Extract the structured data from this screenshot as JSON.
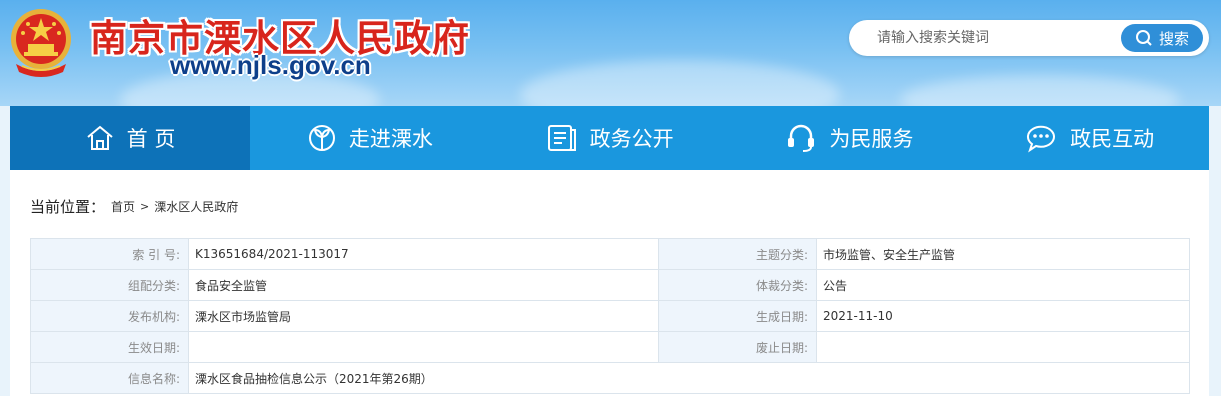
{
  "header": {
    "site_title": "南京市溧水区人民政府",
    "site_url": "www.njls.gov.cn",
    "emblem_icon": "national-emblem-icon"
  },
  "search": {
    "placeholder": "请输入搜索关键词",
    "button_label": "搜索"
  },
  "nav": {
    "items": [
      {
        "label": "首 页",
        "icon": "home-icon"
      },
      {
        "label": "走进溧水",
        "icon": "leaf-icon"
      },
      {
        "label": "政务公开",
        "icon": "document-icon"
      },
      {
        "label": "为民服务",
        "icon": "headset-icon"
      },
      {
        "label": "政民互动",
        "icon": "chat-icon"
      }
    ]
  },
  "breadcrumb": {
    "label": "当前位置：",
    "items": [
      "首页",
      "溧水区人民政府"
    ],
    "separator": ">"
  },
  "info": {
    "rows": [
      [
        {
          "k": "索 引 号:",
          "v": "K13651684/2021-113017"
        },
        {
          "k": "主题分类:",
          "v": "市场监管、安全生产监管"
        }
      ],
      [
        {
          "k": "组配分类:",
          "v": "食品安全监管"
        },
        {
          "k": "体裁分类:",
          "v": "公告"
        }
      ],
      [
        {
          "k": "发布机构:",
          "v": "溧水区市场监管局"
        },
        {
          "k": "生成日期:",
          "v": "2021-11-10"
        }
      ],
      [
        {
          "k": "生效日期:",
          "v": ""
        },
        {
          "k": "废止日期:",
          "v": ""
        }
      ]
    ],
    "title_row": {
      "k": "信息名称:",
      "v": "溧水区食品抽检信息公示（2021年第26期）"
    }
  },
  "colors": {
    "nav_bg": "#1a97de",
    "nav_active": "#0d72b8",
    "title_red": "#d8251c",
    "url_blue": "#0e3f8a"
  }
}
